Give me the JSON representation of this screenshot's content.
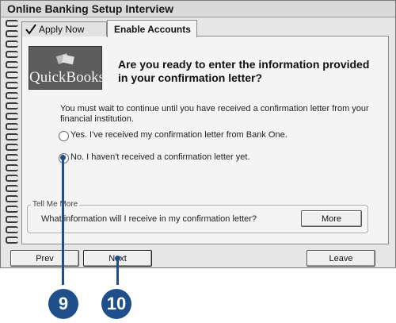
{
  "window": {
    "title": "Online Banking Setup Interview"
  },
  "tabs": [
    {
      "label": "Apply Now",
      "icon": "checkmark-icon"
    },
    {
      "label": "Enable Accounts"
    }
  ],
  "logo": {
    "text": "QuickBooks"
  },
  "main": {
    "question": "Are you ready to enter the information provided in your confirmation letter?",
    "info": "You must wait to continue until you have received a confirmation letter from your financial institution.",
    "options": [
      {
        "label": "Yes. I've received my confirmation letter from Bank One."
      },
      {
        "label": "No. I haven't received a confirmation letter yet."
      }
    ]
  },
  "tell_me_more": {
    "legend": "Tell Me More",
    "question": "What information will I receive in my confirmation letter?",
    "more_label": "More"
  },
  "footer": {
    "prev_label": "Prev",
    "next_label": "Next",
    "leave_label": "Leave"
  },
  "callouts": [
    {
      "label": "9"
    },
    {
      "label": "10"
    }
  ],
  "colors": {
    "callout": "#1f4f8a"
  }
}
